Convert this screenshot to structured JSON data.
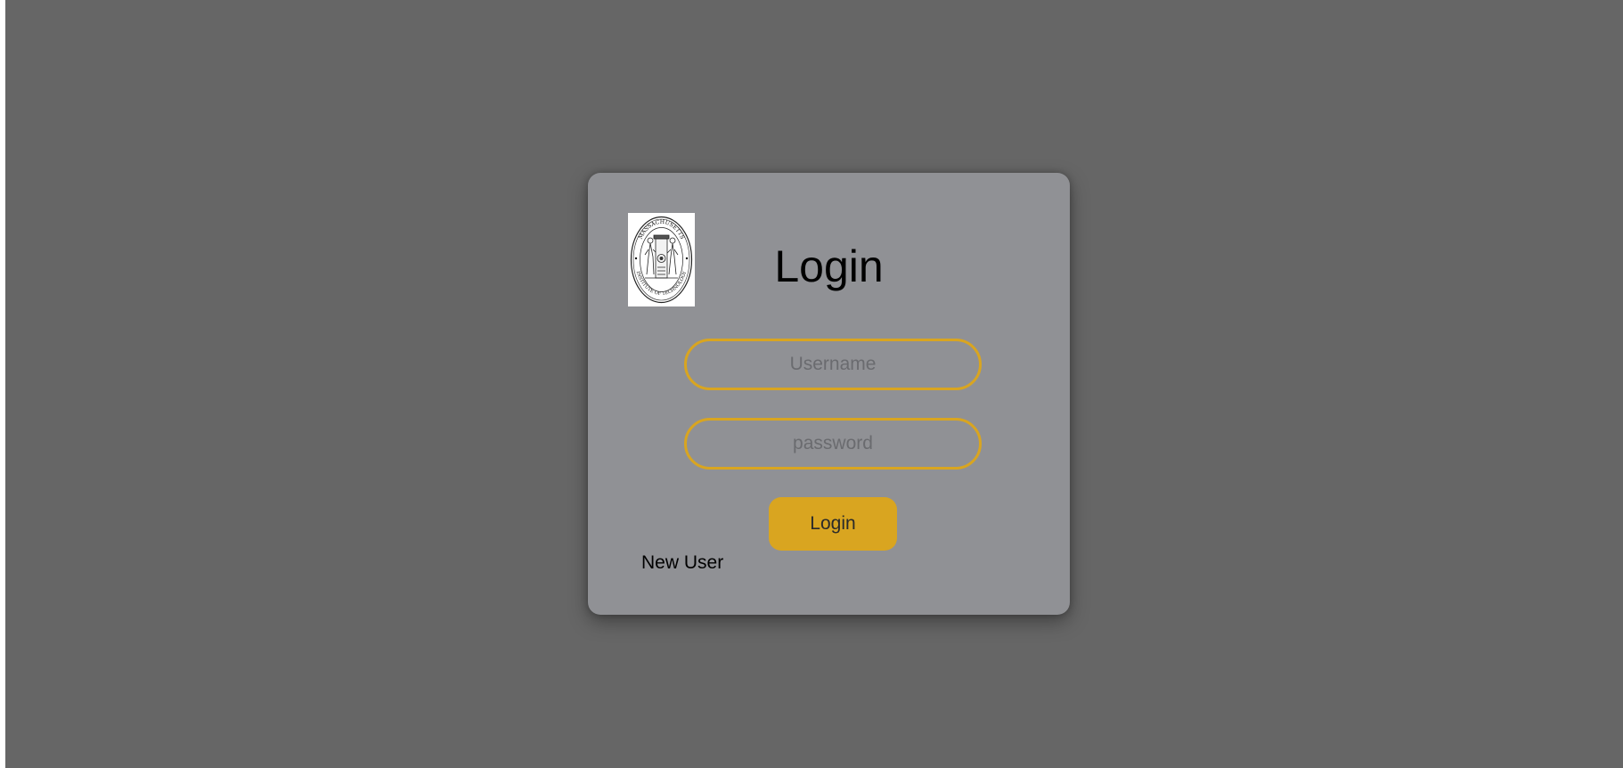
{
  "login_card": {
    "logo": {
      "icon": "mit-seal-icon",
      "seal_text_top": "MASSACHUSETTS",
      "seal_text_bottom": "INSTITUTE OF TECHNOLOGY"
    },
    "title": "Login",
    "username": {
      "value": "",
      "placeholder": "Username"
    },
    "password": {
      "value": "",
      "placeholder": "password"
    },
    "login_button": "Login",
    "new_user_link": "New User"
  },
  "colors": {
    "page_background": "#666666",
    "card_background": "#909195",
    "accent": "#d9a520"
  }
}
